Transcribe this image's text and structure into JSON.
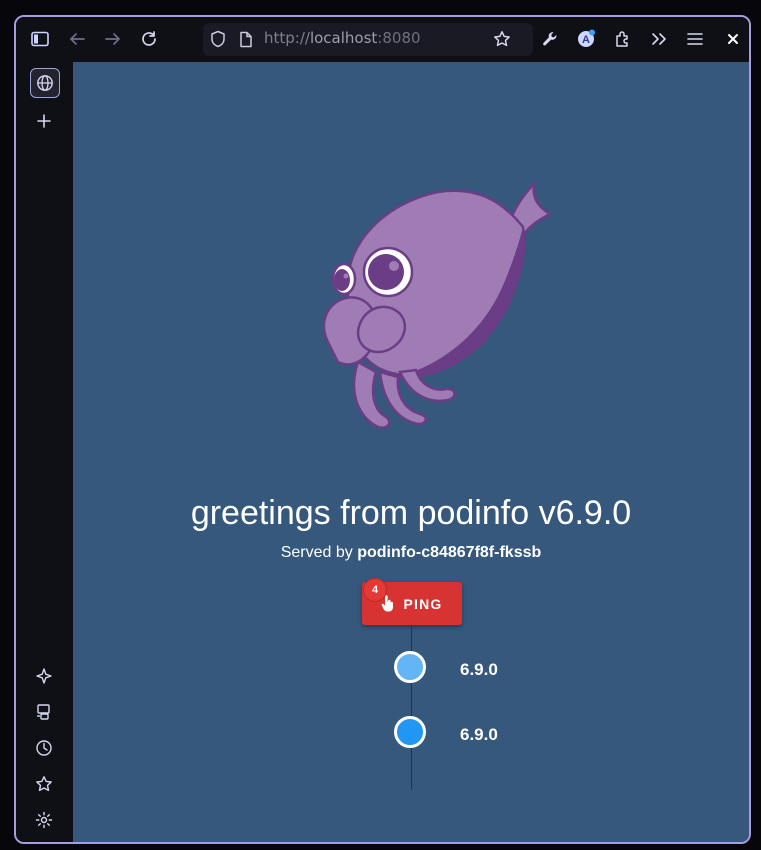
{
  "browser": {
    "url_scheme": "http://",
    "url_host": "localhost",
    "url_port": ":8080",
    "icons": [
      "sidebar-toggle-icon",
      "back-arrow-icon",
      "forward-arrow-icon",
      "reload-icon",
      "shield-icon",
      "page-icon",
      "bookmark-star-icon",
      "wrench-icon",
      "account-icon",
      "extensions-icon",
      "overflow-chevrons-icon",
      "hamburger-menu-icon",
      "close-icon"
    ],
    "sidebar_icons": [
      "globe-icon",
      "plus-icon",
      "sparkle-icon",
      "synced-tabs-icon",
      "history-icon",
      "bookmarks-star-icon",
      "settings-gear-icon"
    ]
  },
  "page": {
    "greeting": "greetings from podinfo v6.9.0",
    "served_prefix": "Served by ",
    "served_host": "podinfo-c84867f8f-fkssb",
    "ping_label": "PING",
    "ping_badge": "4",
    "timeline": [
      {
        "label": "6.9.0",
        "color": "#64b5f6"
      },
      {
        "label": "6.9.0",
        "color": "#2196f3"
      }
    ]
  },
  "colors": {
    "content_bg": "#36587c",
    "ping_button": "#d83333",
    "window_border": "#a99be0",
    "mascot_body": "#a07cb5",
    "mascot_shadow": "#6b3d86"
  }
}
